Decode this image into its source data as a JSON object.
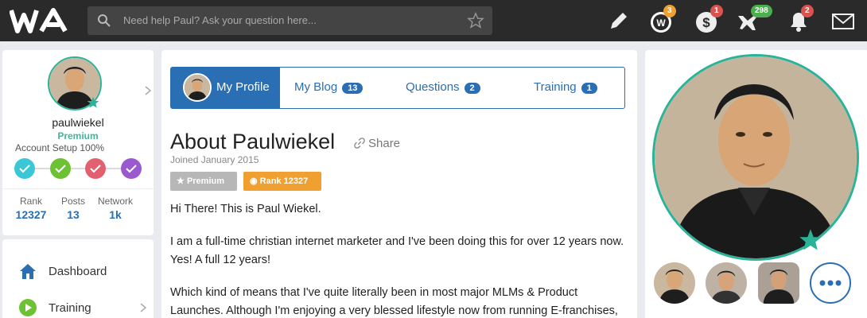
{
  "topbar": {
    "search_placeholder": "Need help Paul? Ask your question here...",
    "badges": {
      "wa": "3",
      "money": "1",
      "plane": "298",
      "bell": "2"
    }
  },
  "profile": {
    "username": "paulwiekel",
    "membership": "Premium",
    "setup": "Account Setup 100%",
    "stats": [
      {
        "label": "Rank",
        "value": "12327"
      },
      {
        "label": "Posts",
        "value": "13"
      },
      {
        "label": "Network",
        "value": "1k"
      }
    ]
  },
  "nav": [
    {
      "label": "Dashboard"
    },
    {
      "label": "Training"
    }
  ],
  "tabs": {
    "active": "My Profile",
    "blog": {
      "label": "My Blog",
      "count": "13"
    },
    "questions": {
      "label": "Questions",
      "count": "2"
    },
    "training": {
      "label": "Training",
      "count": "1"
    }
  },
  "about": {
    "title": "About Paulwiekel",
    "share": "Share",
    "joined": "Joined January 2015",
    "badge_premium": "Premium",
    "badge_rank": "Rank 12327",
    "p1": "Hi There! This is Paul Wiekel.",
    "p2": "I am a full-time christian internet marketer and I've been doing this for over 12 years now. Yes! A full 12 years!",
    "p3": "Which kind of means that I've quite literally been in most major MLMs & Product Launches. Although I'm enjoying a very blessed lifestyle now from running E-franchises,"
  },
  "colors": {
    "accent": "#2a6eb3",
    "teal": "#2bb39a",
    "badge_orange": "#f0a030",
    "badge_red": "#d9534f",
    "badge_green": "#4cae4c"
  }
}
